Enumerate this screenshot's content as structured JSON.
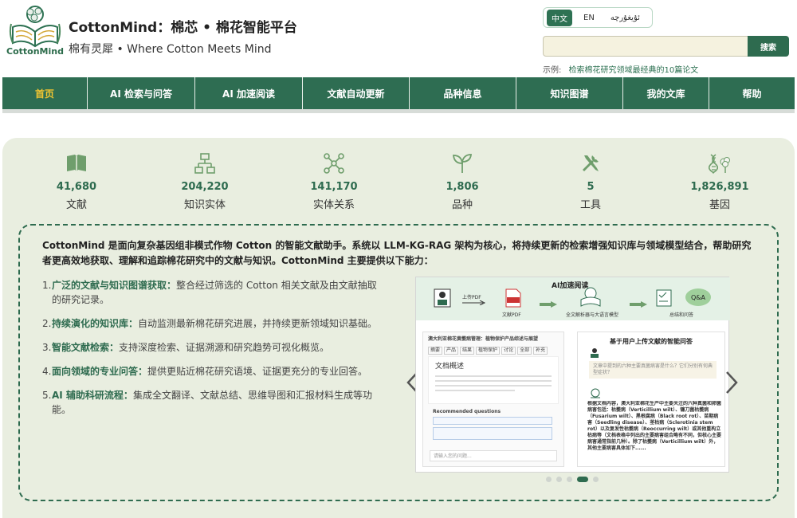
{
  "brand": {
    "logo_text": "CottonMind",
    "title": "CottonMind：棉芯 • 棉花智能平台",
    "subtitle": "棉有灵犀 • Where Cotton Meets Mind"
  },
  "lang": {
    "options": [
      "中文",
      "EN",
      "ئۇيغۇرچە"
    ],
    "active": "中文"
  },
  "search": {
    "placeholder": "",
    "button_label": "搜索",
    "example_prefix": "示例:",
    "example_link": "检索棉花研究领域最经典的10篇论文"
  },
  "nav": {
    "items": [
      "首页",
      "AI 检索与问答",
      "AI 加速阅读",
      "文献自动更新",
      "品种信息",
      "知识图谱",
      "我的文库",
      "帮助"
    ],
    "active_index": 0
  },
  "stats": [
    {
      "icon": "book-icon",
      "value": "41,680",
      "label": "文献"
    },
    {
      "icon": "hierarchy-icon",
      "value": "204,220",
      "label": "知识实体"
    },
    {
      "icon": "network-icon",
      "value": "141,170",
      "label": "实体关系"
    },
    {
      "icon": "sprout-icon",
      "value": "1,806",
      "label": "品种"
    },
    {
      "icon": "tools-icon",
      "value": "5",
      "label": "工具"
    },
    {
      "icon": "dna-cotton-icon",
      "value": "1,826,891",
      "label": "基因"
    }
  ],
  "intro": "CottonMind 是面向复杂基因组非模式作物 Cotton 的智能文献助手。系统以 LLM-KG-RAG 架构为核心，将持续更新的检索增强知识库与领域模型结合，帮助研究者更高效地获取、理解和追踪棉花研究中的文献与知识。CottonMind 主要提供以下能力：",
  "features": [
    {
      "num": "1.",
      "title": "广泛的文献与知识图谱获取：",
      "text": "整合经过筛选的 Cotton 相关文献及由文献抽取的研究记录。"
    },
    {
      "num": "2.",
      "title": "持续演化的知识库：",
      "text": "自动监测最新棉花研究进展，并持续更新领域知识基础。"
    },
    {
      "num": "3.",
      "title": "智能文献检索：",
      "text": "支持深度检索、证据溯源和研究趋势可视化概览。"
    },
    {
      "num": "4.",
      "title": "面向领域的专业问答：",
      "text": "提供更贴近棉花研究语境、证据更充分的专业回答。"
    },
    {
      "num": "5.",
      "title": "AI 辅助科研流程：",
      "text": "集成全文翻译、文献总结、思维导图和汇报材料生成等功能。"
    }
  ],
  "slide": {
    "title": "AI加速阅读",
    "steps": [
      "上传PDF",
      "文献PDF",
      "全文解析器与大语言模型",
      "总结和问答"
    ],
    "qa_bubble": "Q&A",
    "doc_header": "澳大利亚棉花黄萎病管理：植物保护产品综述与展望",
    "doc_tabs": [
      "摘要",
      "产品",
      "结果",
      "植物保护",
      "讨论",
      "全部",
      "补充"
    ],
    "doc_section": "文档概述",
    "recommended": "Recommended questions",
    "input_placeholder": "请输入您的问题...",
    "right_title": "基于用户上传文献的智能问答",
    "right_question": "文章中提到的六种主要真菌病害是什么？它们分别有何典型症状？",
    "right_answer": "根据文档内容，澳大利亚棉花生产中主要关注的六种真菌和卵菌病害包括：枯萎病（Verticillium wilt）、镰刀菌枯萎病（Fusarium wilt）、黑根腐病（Black root rot）、苗期病害（Seedling disease）、茎枯病（Sclerotinia stem rot）以及复发性枯萎病（Reoccurring wilt）或其他重构立枯病等（文档表格中列出的主要病害组合略有不同，但核心主要病害通常指前几种）。除了枯萎病（Verticillium wilt）外，其他主要病害具体如下......"
  },
  "carousel": {
    "dot_count": 5,
    "active_dot": 3
  },
  "colors": {
    "primary": "#2e6d52",
    "accent": "#f2c531",
    "panel_bg": "#e9eee0"
  }
}
